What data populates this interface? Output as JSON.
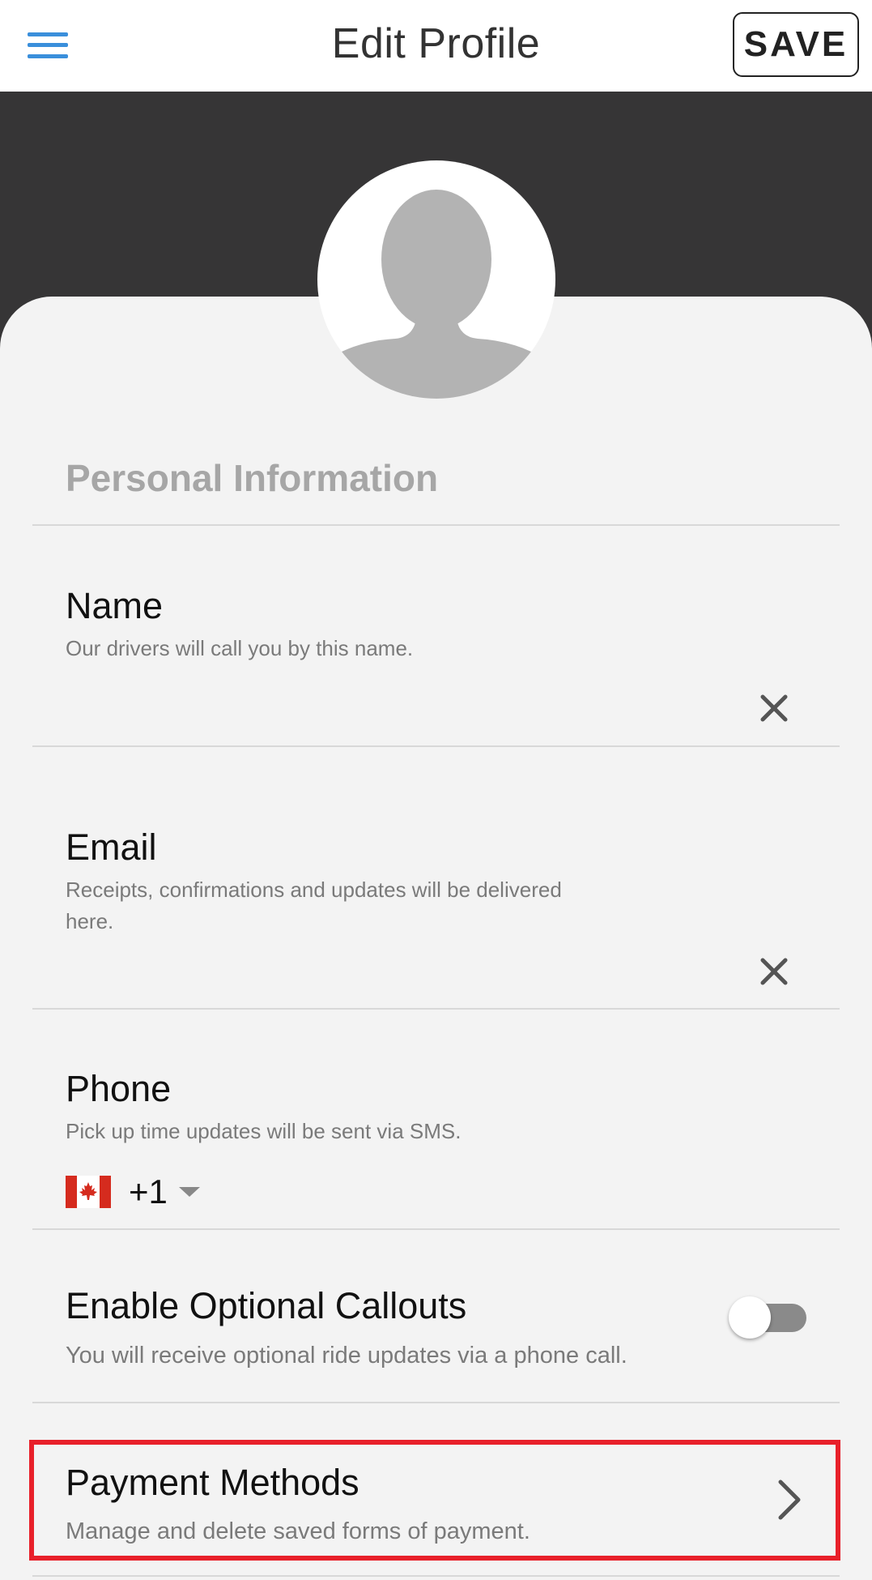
{
  "header": {
    "title": "Edit Profile",
    "save_label": "SAVE",
    "menu_icon": "hamburger-menu-icon"
  },
  "colors": {
    "accent": "#3a8fdb",
    "hero_background": "#363536",
    "highlight": "#e8202a"
  },
  "personal": {
    "section_title": "Personal Information"
  },
  "name": {
    "label": "Name",
    "hint": "Our drivers will call you by this name.",
    "value": ""
  },
  "email": {
    "label": "Email",
    "hint_line1": "Receipts, confirmations and updates will be delivered",
    "hint_line2": "here.",
    "value": ""
  },
  "phone": {
    "label": "Phone",
    "hint": "Pick up time updates will be sent via SMS.",
    "country_flag": "canada-flag-icon",
    "dial_code": "+1"
  },
  "callouts": {
    "label": "Enable Optional Callouts",
    "hint": "You will receive optional ride updates via a phone call.",
    "enabled": false
  },
  "payment": {
    "label": "Payment Methods",
    "hint": "Manage and delete saved forms of payment."
  }
}
